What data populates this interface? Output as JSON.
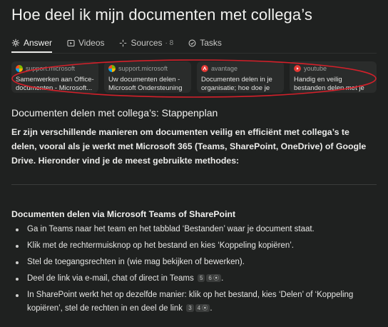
{
  "page": {
    "title": "Hoe deel ik mijn documenten met collega’s"
  },
  "tabs": [
    {
      "label": "Answer",
      "icon": "answer-icon"
    },
    {
      "label": "Videos",
      "icon": "video-icon"
    },
    {
      "label": "Sources",
      "icon": "sources-icon",
      "count": "8"
    },
    {
      "label": "Tasks",
      "icon": "tasks-icon"
    }
  ],
  "sources": [
    {
      "site": "support.microsoft",
      "title": "Samenwerken aan Office-documenten - Microsoft...",
      "favicon": "microsoft-logo-icon"
    },
    {
      "site": "support.microsoft",
      "title": "Uw documenten delen - Microsoft Ondersteuning",
      "favicon": "microsoft-logo-icon"
    },
    {
      "site": "avantage",
      "title": "Documenten delen in je organisatie; hoe doe je dat...",
      "favicon": "avantage-logo-icon",
      "favicon_color": "#e53935"
    },
    {
      "site": "youtube",
      "title": "Handig en veilig bestanden delen met je collega's via ...",
      "favicon": "youtube-logo-icon",
      "favicon_color": "#e53935"
    }
  ],
  "annotation": {
    "color": "#d4202a"
  },
  "answer": {
    "heading": "Documenten delen met collega’s: Stappenplan",
    "intro": "Er zijn verschillende manieren om documenten veilig en efficiënt met collega’s te delen, vooral als je werkt met Microsoft 365 (Teams, SharePoint, OneDrive) of Google Drive. Hieronder vind je de meest gebruikte methodes:",
    "section_title": "Documenten delen via Microsoft Teams of SharePoint",
    "steps": [
      {
        "text": "Ga in Teams naar het team en het tabblad ‘Bestanden’ waar je document staat."
      },
      {
        "text": "Klik met de rechtermuisknop op het bestand en kies ‘Koppeling kopiëren’."
      },
      {
        "text": "Stel de toegangsrechten in (wie mag bekijken of bewerken)."
      },
      {
        "text": "Deel de link via e-mail, chat of direct in Teams",
        "cites": [
          "5",
          "6"
        ]
      },
      {
        "text": "In SharePoint werkt het op dezelfde manier: klik op het bestand, kies ‘Delen’ of ‘Koppeling kopiëren’, stel de rechten in en deel de link",
        "cites": [
          "3",
          "4"
        ],
        "suffix": "."
      }
    ],
    "step4_suffix": "."
  }
}
